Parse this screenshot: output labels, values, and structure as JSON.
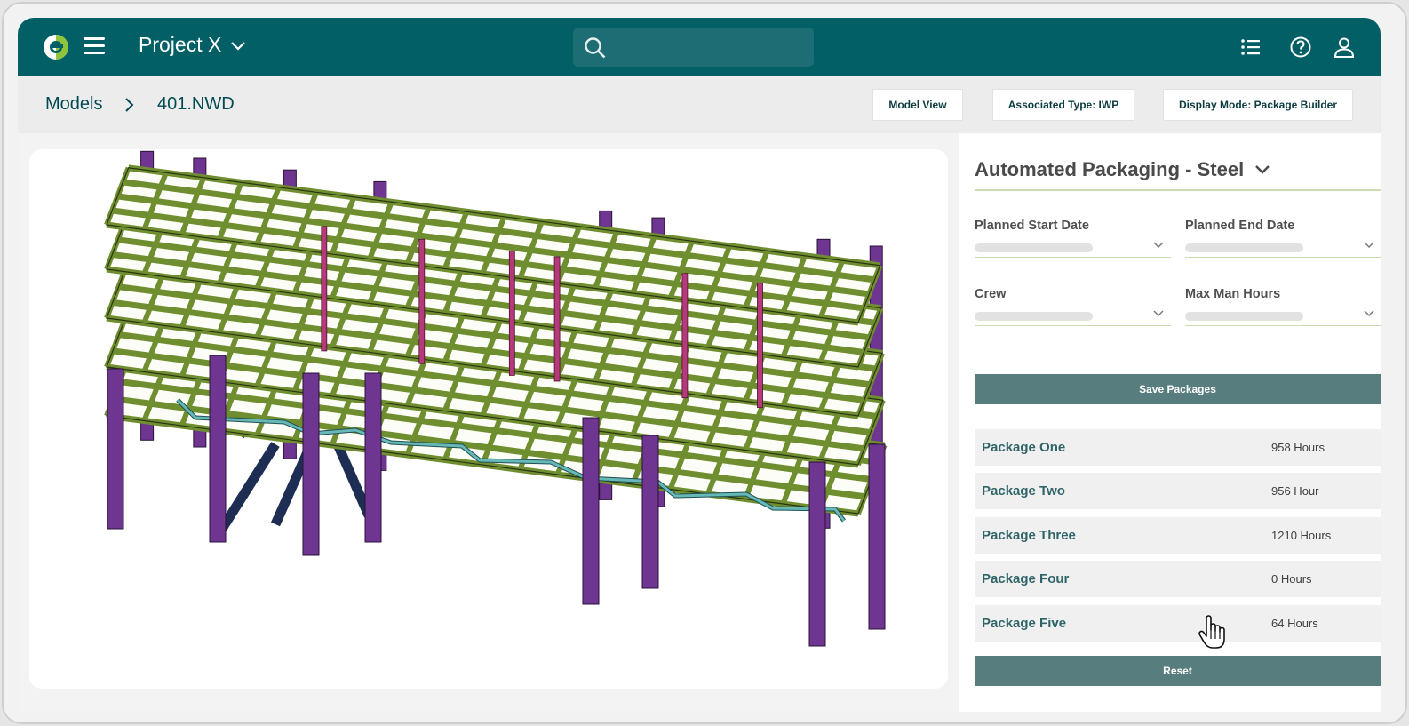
{
  "header": {
    "project_name": "Project X",
    "logo_icon": "company-logo-icon",
    "menu_icon": "hamburger-menu-icon",
    "search_icon": "search-icon",
    "right_icons": [
      "list-icon",
      "help-icon",
      "user-icon"
    ]
  },
  "breadcrumb": {
    "items": [
      "Models",
      "401.NWD"
    ]
  },
  "toolbar": {
    "model_view_label": "Model View",
    "associated_type_label": "Associated Type: IWP",
    "display_mode_label": "Display Mode: Package Builder"
  },
  "panel": {
    "title": "Automated Packaging - Steel",
    "fields": {
      "planned_start_label": "Planned Start Date",
      "planned_end_label": "Planned End Date",
      "crew_label": "Crew",
      "max_man_hours_label": "Max Man Hours"
    },
    "save_label": "Save Packages",
    "reset_label": "Reset",
    "packages": [
      {
        "name": "Package One",
        "hours": "958 Hours"
      },
      {
        "name": "Package Two",
        "hours": "956 Hour"
      },
      {
        "name": "Package Three",
        "hours": "1210 Hours"
      },
      {
        "name": "Package Four",
        "hours": "0 Hours"
      },
      {
        "name": "Package Five",
        "hours": "64 Hours"
      }
    ]
  },
  "colors": {
    "header_bg": "#025f66",
    "accent_button": "#587d7e",
    "beam_green": "#6f8e2f",
    "column_purple": "#6e3591",
    "brace_navy": "#1d2d53",
    "pipe_teal": "#66b9b6"
  }
}
